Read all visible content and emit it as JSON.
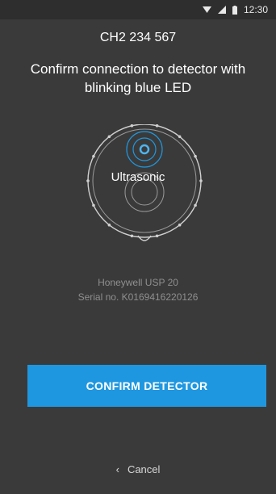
{
  "status_bar": {
    "time": "12:30",
    "icons": [
      "wifi-icon",
      "signal-icon",
      "battery-icon"
    ]
  },
  "header": {
    "device_id": "CH2 234 567"
  },
  "instruction": "Confirm connection to detector with blinking blue LED",
  "detector": {
    "label": "Ultrasonic",
    "model": "Honeywell USP 20",
    "serial": "Serial no. K0169416220126"
  },
  "actions": {
    "confirm_label": "CONFIRM DETECTOR",
    "cancel_label": "Cancel"
  },
  "colors": {
    "background": "#3a3a3a",
    "accent": "#1f97e0",
    "led": "#1f97e0"
  }
}
